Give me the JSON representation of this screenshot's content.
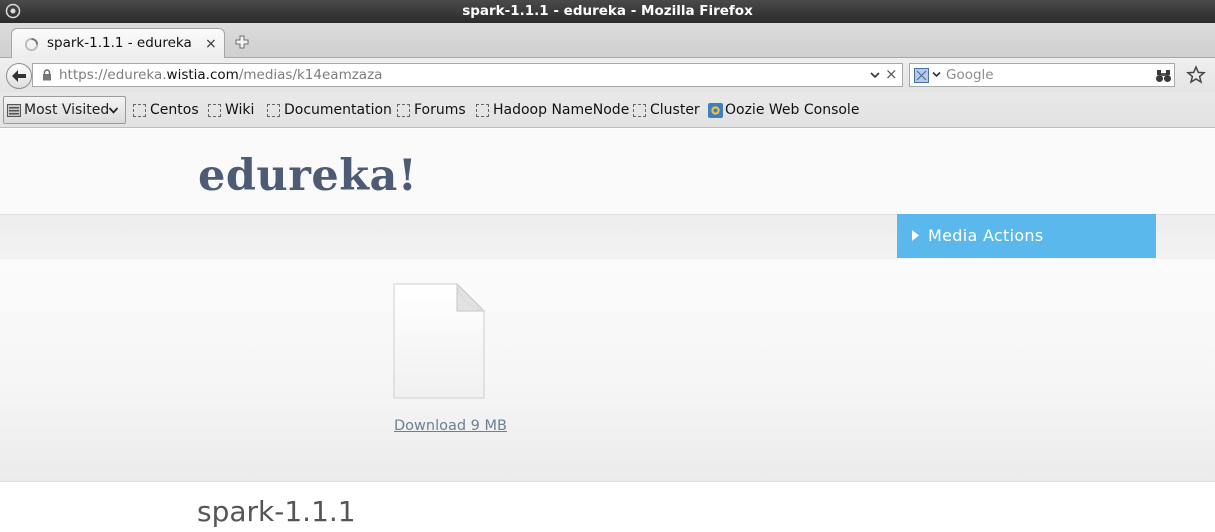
{
  "window": {
    "title": "spark-1.1.1 - edureka - Mozilla Firefox"
  },
  "tab": {
    "label": "spark-1.1.1 - edureka",
    "close_glyph": "×"
  },
  "nav": {
    "url_prefix": "https://edureka.",
    "url_host": "wistia.com",
    "url_path": "/medias/k14eamzaza",
    "stop_glyph": "×",
    "search_placeholder": "Google"
  },
  "bookmarks": {
    "most_visited": "Most Visited",
    "items": [
      "Centos",
      "Wiki",
      "Documentation",
      "Forums",
      "Hadoop NameNode",
      "Cluster",
      "Oozie Web Console"
    ]
  },
  "page": {
    "logo": "edureka!",
    "media_actions": "Media Actions",
    "download": "Download 9 MB",
    "media_title": "spark-1.1.1"
  },
  "colors": {
    "accent": "#5bb8ec",
    "logo": "#4d5b75"
  }
}
